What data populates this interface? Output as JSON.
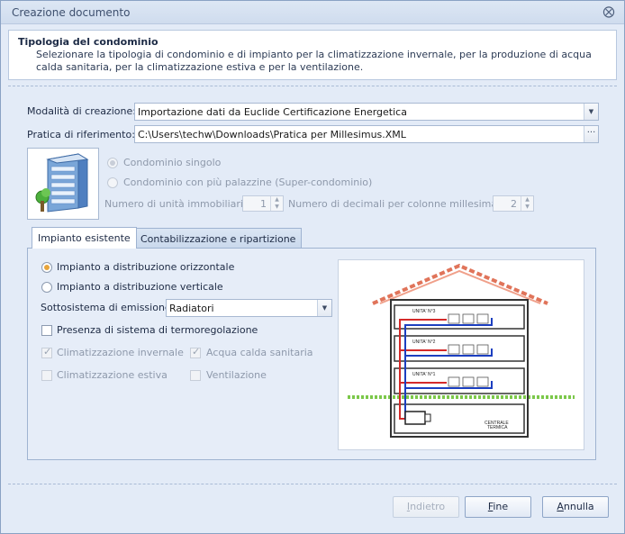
{
  "window": {
    "title": "Creazione documento",
    "close_icon": "close-icon"
  },
  "header": {
    "title": "Tipologia del condominio",
    "description": "Selezionare la tipologia di condominio e di impianto per la climatizzazione invernale, per la produzione di acqua calda sanitaria, per la climatizzazione estiva e per la ventilazione."
  },
  "form": {
    "modalita_label": "Modalità di creazione:",
    "modalita_value": "Importazione dati da Euclide Certificazione Energetica",
    "pratica_label": "Pratica di riferimento:",
    "pratica_value": "C:\\Users\\techw\\Downloads\\Pratica per Millesimus.XML",
    "browse_label": "···"
  },
  "tipologia": {
    "building_icon": "building-icon",
    "singolo_label": "Condominio singolo",
    "super_label": "Condominio con più palazzine (Super-condominio)",
    "unita_label": "Numero di unità immobiliari:",
    "unita_value": "1",
    "decimali_label": "Numero di decimali per colonne millesimali:",
    "decimali_value": "2"
  },
  "tabs": [
    {
      "label": "Impianto esistente",
      "active": true
    },
    {
      "label": "Contabilizzazione e ripartizione",
      "active": false
    }
  ],
  "impianto": {
    "orizzontale_label": "Impianto a distribuzione orizzontale",
    "verticale_label": "Impianto a distribuzione verticale",
    "sottosistema_label": "Sottosistema di emissione:",
    "sottosistema_value": "Radiatori",
    "termoregolazione_label": "Presenza di sistema di termoregolazione",
    "clim_invernale_label": "Climatizzazione invernale",
    "acqua_calda_label": "Acqua calda sanitaria",
    "clim_estiva_label": "Climatizzazione estiva",
    "ventilazione_label": "Ventilazione"
  },
  "diagram": {
    "floor3": "UNITA' N°3",
    "floor2": "UNITA' N°2",
    "floor1": "UNITA' N°1",
    "centrale": "CENTRALE",
    "termica": "TERMICA"
  },
  "buttons": {
    "back_pre": "",
    "back_ul": "I",
    "back_post": "ndietro",
    "finish_pre": "",
    "finish_ul": "F",
    "finish_post": "ine",
    "cancel_pre": "",
    "cancel_ul": "A",
    "cancel_post": "nnulla"
  },
  "colors": {
    "accent": "#e8a53c",
    "hot_pipe": "#d42a2a",
    "cold_pipe": "#1c3fc0",
    "roof": "#e0745a",
    "ground": "#7cc84a"
  }
}
